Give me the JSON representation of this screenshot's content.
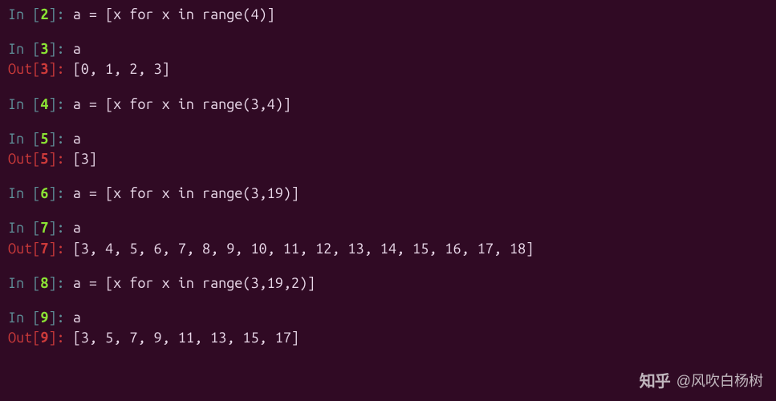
{
  "cells": [
    {
      "in_num": "2",
      "code": "a = [x for x in range(4)]"
    },
    {
      "in_num": "3",
      "code": "a",
      "out_num": "3",
      "output": "[0, 1, 2, 3]"
    },
    {
      "in_num": "4",
      "code": "a = [x for x in range(3,4)]"
    },
    {
      "in_num": "5",
      "code": "a",
      "out_num": "5",
      "output": "[3]"
    },
    {
      "in_num": "6",
      "code": "a = [x for x in range(3,19)]"
    },
    {
      "in_num": "7",
      "code": "a",
      "out_num": "7",
      "output": "[3, 4, 5, 6, 7, 8, 9, 10, 11, 12, 13, 14, 15, 16, 17, 18]"
    },
    {
      "in_num": "8",
      "code": "a = [x for x in range(3,19,2)]"
    },
    {
      "in_num": "9",
      "code": "a",
      "out_num": "9",
      "output": "[3, 5, 7, 9, 11, 13, 15, 17]"
    }
  ],
  "labels": {
    "in": "In ",
    "out": "Out"
  },
  "watermark": {
    "logo": "知乎",
    "text": "@风吹白杨树"
  }
}
